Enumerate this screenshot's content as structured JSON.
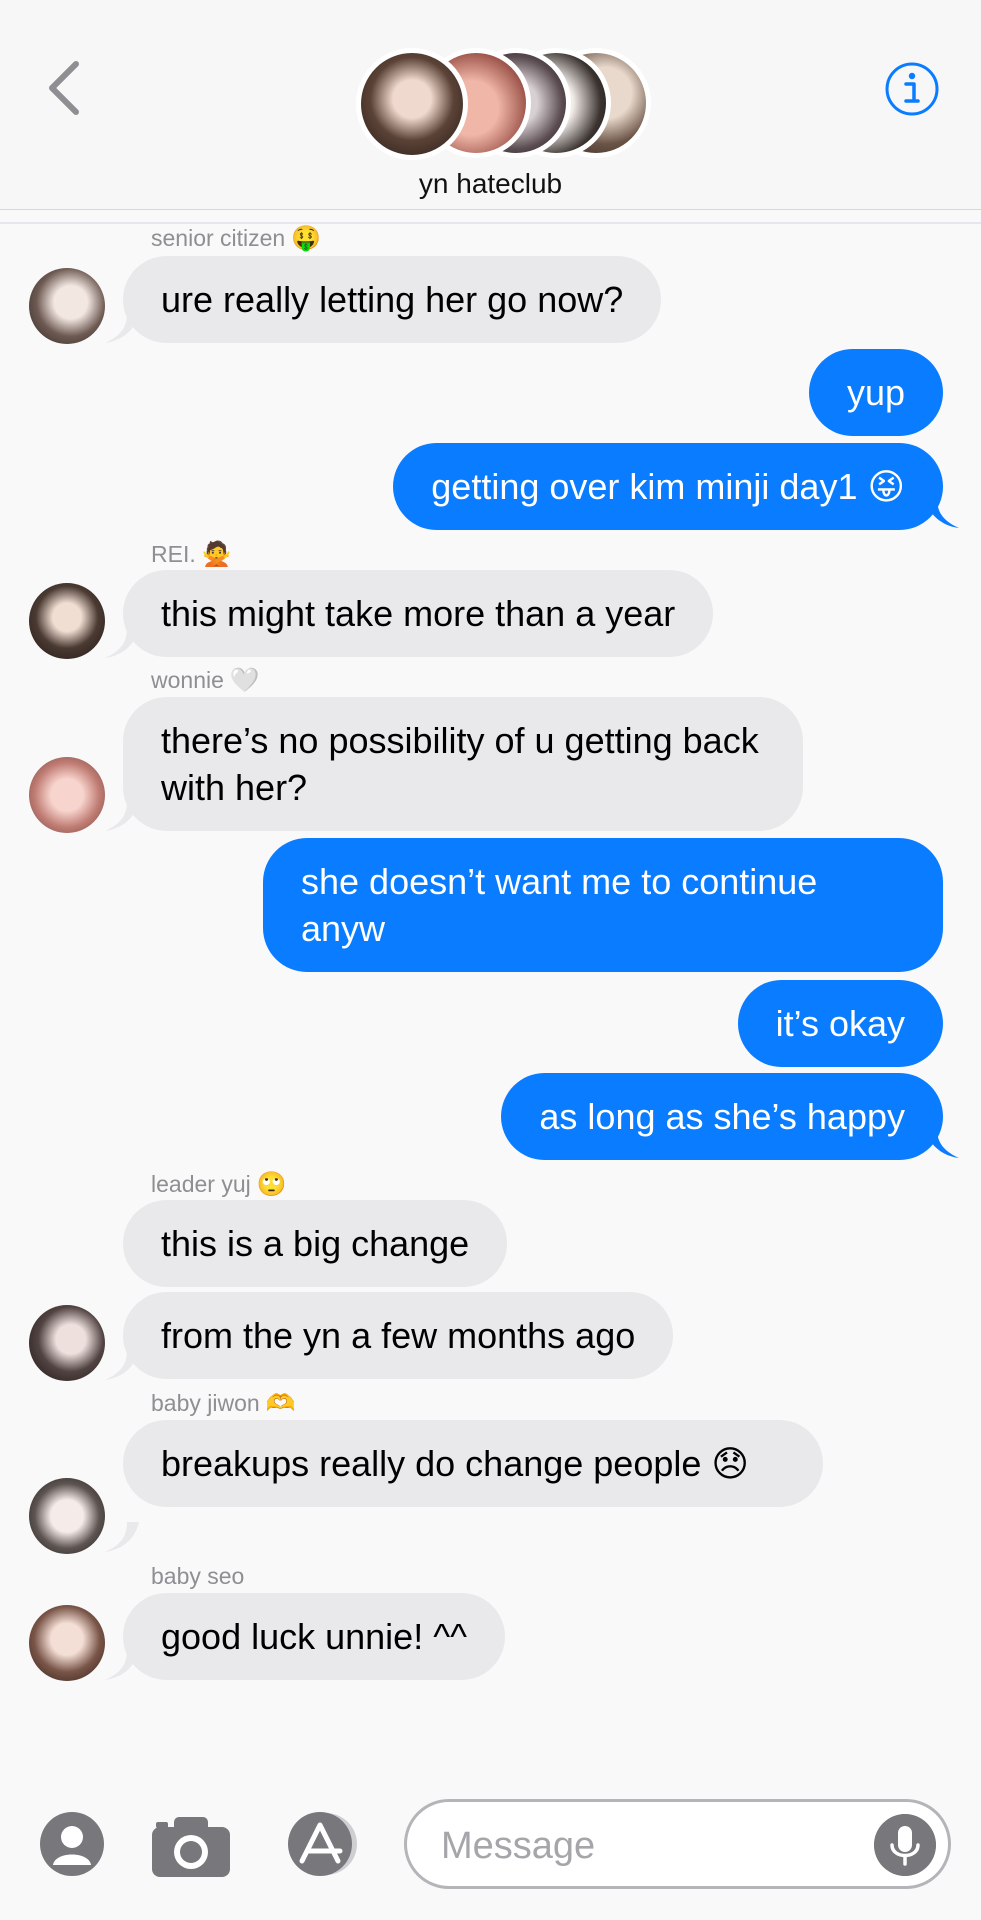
{
  "header": {
    "group_name": "yn hateclub"
  },
  "messages": [
    {
      "sender": "senior citizen",
      "sender_emoji": "🤑",
      "text": "ure really letting her go now?"
    },
    {
      "text": "yup"
    },
    {
      "text": "getting over kim minji day1 😝"
    },
    {
      "sender": "REI.",
      "sender_emoji": "🙅",
      "text": "this might take more than a year"
    },
    {
      "sender": "wonnie",
      "sender_emoji": "🤍",
      "text": "there’s no possibility of u getting back with her?"
    },
    {
      "text": "she doesn’t want me to continue anyw"
    },
    {
      "text": "it’s okay"
    },
    {
      "text": "as long as she’s happy"
    },
    {
      "sender": "leader yuj",
      "sender_emoji": "🙄",
      "text": "this is a big change"
    },
    {
      "text": "from the yn a few months ago"
    },
    {
      "sender": "baby jiwon",
      "sender_emoji": "🫶",
      "text": "breakups really do change people 😞"
    },
    {
      "sender": "baby seo",
      "text": "good luck unnie! ^^"
    }
  ],
  "composer": {
    "placeholder": "Message"
  },
  "colors": {
    "outgoing_bubble": "#0a7cff",
    "incoming_bubble": "#e9e9eb",
    "accent": "#0a7cff"
  },
  "icons": [
    "back-chevron-icon",
    "info-icon",
    "avatar-icon",
    "camera-icon",
    "app-store-icon",
    "microphone-icon"
  ]
}
